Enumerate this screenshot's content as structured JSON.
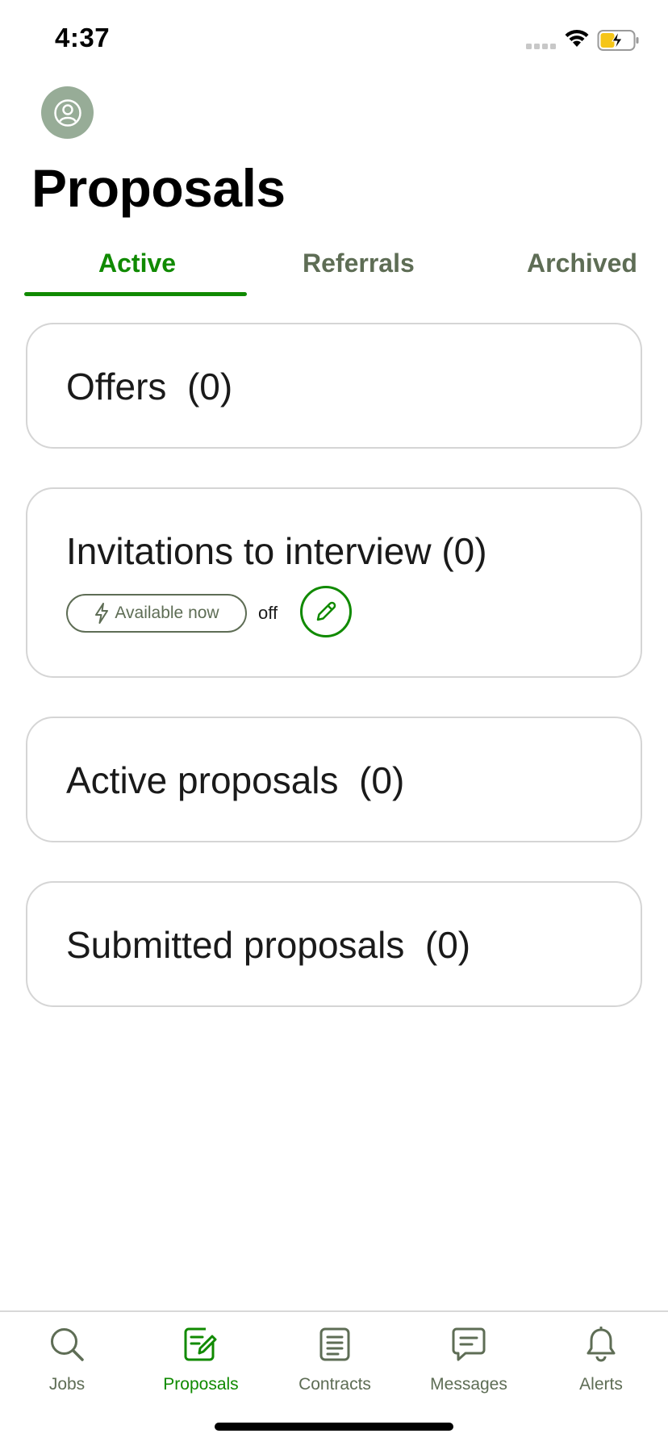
{
  "status_bar": {
    "time": "4:37"
  },
  "header": {
    "title": "Proposals"
  },
  "tabs": [
    {
      "label": "Active",
      "selected": true
    },
    {
      "label": "Referrals",
      "selected": false
    },
    {
      "label": "Archived",
      "selected": false
    }
  ],
  "cards": {
    "offers": {
      "title": "Offers  (0)"
    },
    "invitations": {
      "title": "Invitations to interview (0)",
      "availability_chip": "Available now",
      "availability_status": "off"
    },
    "active_proposals": {
      "title": "Active proposals  (0)"
    },
    "submitted_proposals": {
      "title": "Submitted proposals  (0)"
    }
  },
  "bottom_nav": [
    {
      "label": "Jobs",
      "icon": "search-icon",
      "active": false
    },
    {
      "label": "Proposals",
      "icon": "proposals-icon",
      "active": true
    },
    {
      "label": "Contracts",
      "icon": "contracts-icon",
      "active": false
    },
    {
      "label": "Messages",
      "icon": "messages-icon",
      "active": false
    },
    {
      "label": "Alerts",
      "icon": "bell-icon",
      "active": false
    }
  ],
  "colors": {
    "accent": "#108a00",
    "muted_text": "#5e6d55",
    "avatar_bg": "#97ac97",
    "card_border": "#d5d5d5"
  }
}
